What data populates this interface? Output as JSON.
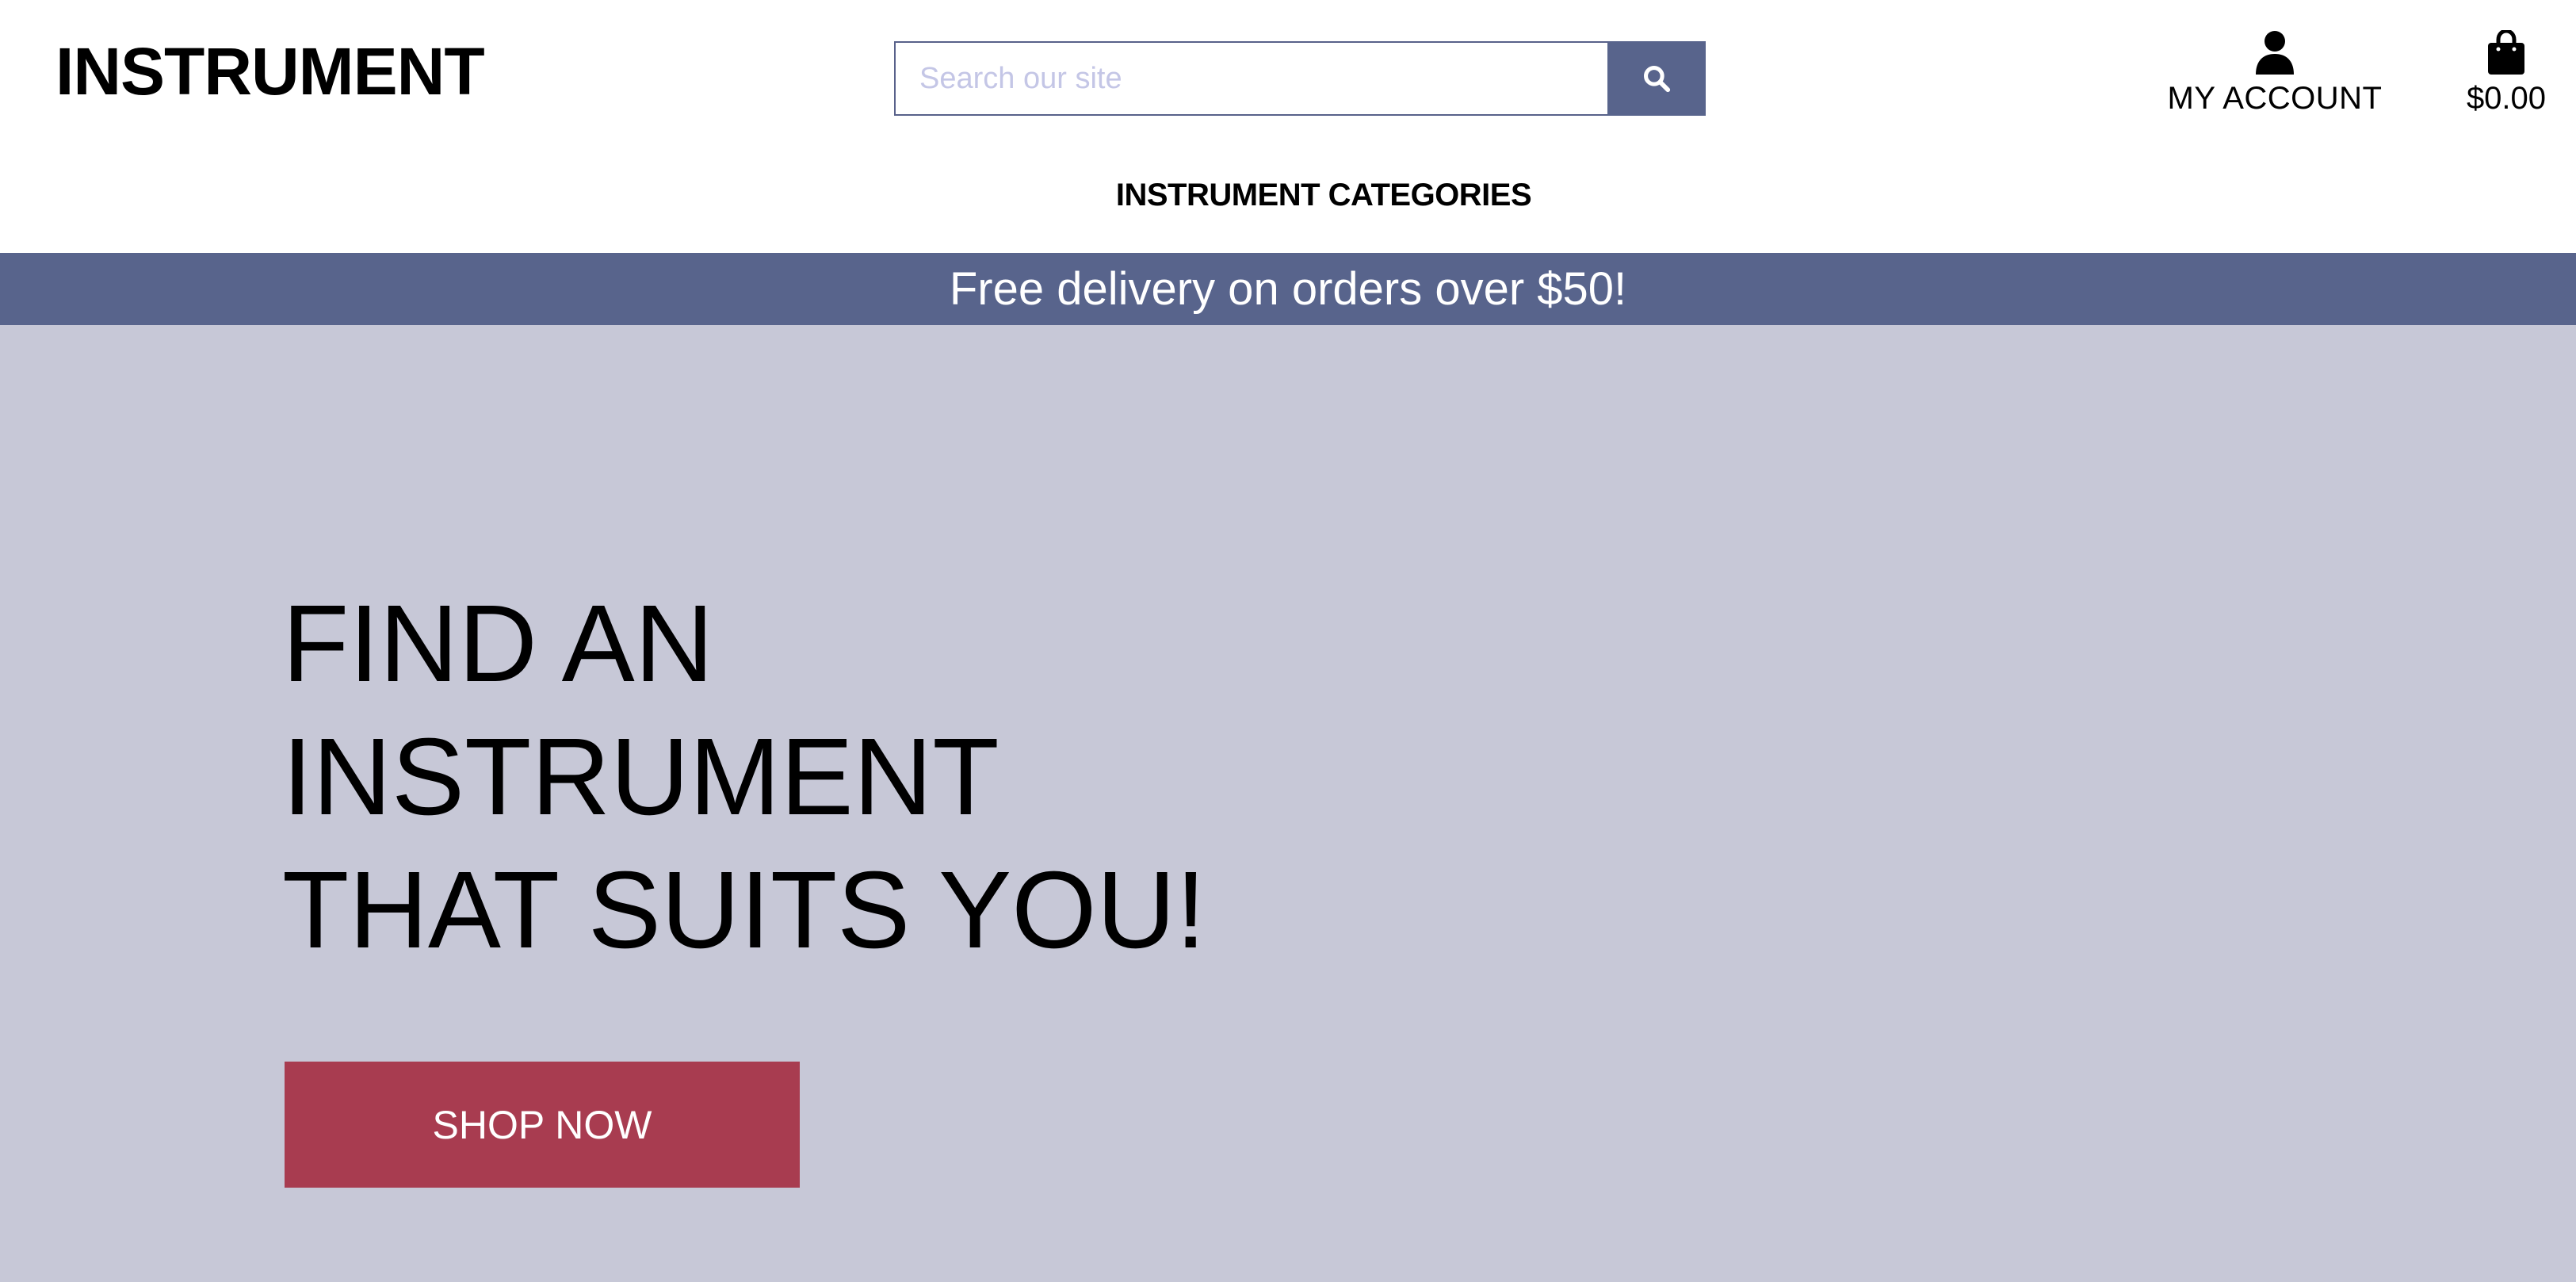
{
  "header": {
    "brand": "INSTRUMENT",
    "search": {
      "placeholder": "Search our site",
      "value": "",
      "button_icon": "search-icon"
    },
    "account": {
      "label": "MY ACCOUNT",
      "icon": "user-icon"
    },
    "bag": {
      "label": "$0.00",
      "icon": "shopping-bag-icon"
    },
    "nav": {
      "categories_label": "INSTRUMENT CATEGORIES"
    }
  },
  "promo": {
    "text": "Free delivery on orders over $50!"
  },
  "hero": {
    "title_lines": [
      "FIND AN",
      "INSTRUMENT",
      "THAT SUITS YOU!"
    ],
    "cta_label": "SHOP NOW"
  },
  "colors": {
    "accent": "#58648c",
    "hero_background": "#c7c8d7",
    "cta": "#a83c50",
    "placeholder": "#c4c6e6"
  }
}
